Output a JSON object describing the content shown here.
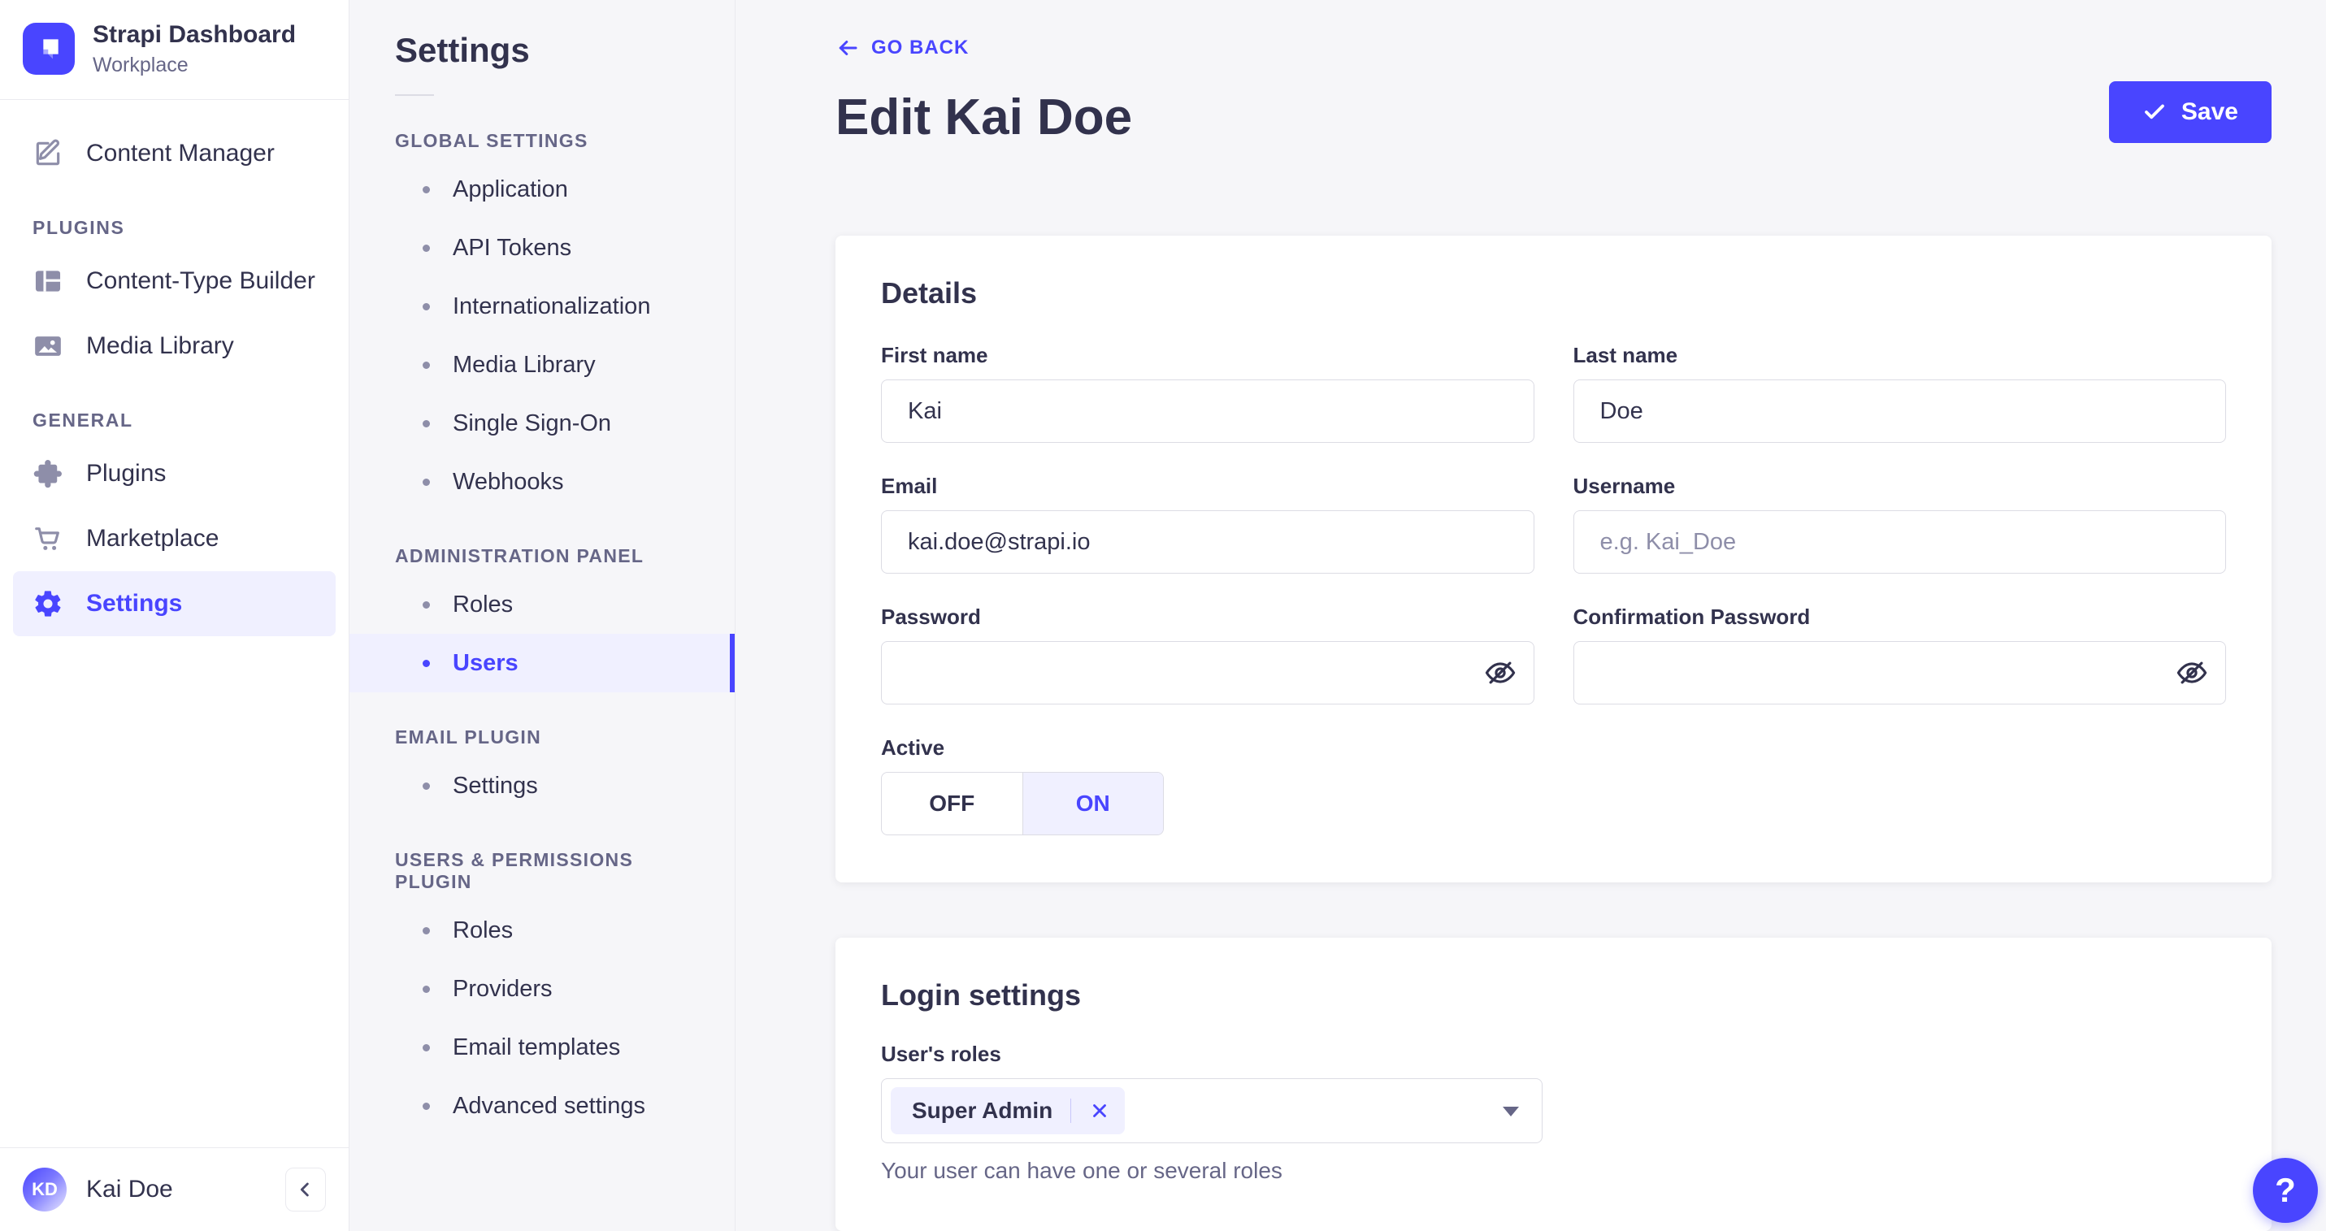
{
  "colors": {
    "primary": "#4945ff",
    "primary_light": "#f0f0ff",
    "text_dark": "#32324d",
    "text_muted": "#666687",
    "border": "#dcdce4",
    "divider": "#eaeaef",
    "background": "#f6f6f9",
    "surface": "#ffffff"
  },
  "main_sidebar": {
    "brand": {
      "title": "Strapi Dashboard",
      "subtitle": "Workplace",
      "logo_icon": "strapi-logo-icon"
    },
    "top_items": [
      {
        "label": "Content Manager",
        "icon": "pen-square-icon"
      }
    ],
    "sections": [
      {
        "label": "PLUGINS",
        "items": [
          {
            "label": "Content-Type Builder",
            "icon": "layout-grid-icon"
          },
          {
            "label": "Media Library",
            "icon": "image-icon"
          }
        ]
      },
      {
        "label": "GENERAL",
        "items": [
          {
            "label": "Plugins",
            "icon": "puzzle-icon"
          },
          {
            "label": "Marketplace",
            "icon": "cart-icon"
          },
          {
            "label": "Settings",
            "icon": "gear-icon",
            "active": true
          }
        ]
      }
    ],
    "user": {
      "name": "Kai Doe",
      "initials": "KD"
    },
    "collapse_icon": "chevron-left-icon"
  },
  "subnav": {
    "title": "Settings",
    "sections": [
      {
        "label": "GLOBAL SETTINGS",
        "items": [
          {
            "label": "Application"
          },
          {
            "label": "API Tokens"
          },
          {
            "label": "Internationalization"
          },
          {
            "label": "Media Library"
          },
          {
            "label": "Single Sign-On"
          },
          {
            "label": "Webhooks"
          }
        ]
      },
      {
        "label": "ADMINISTRATION PANEL",
        "items": [
          {
            "label": "Roles"
          },
          {
            "label": "Users",
            "active": true
          }
        ]
      },
      {
        "label": "EMAIL PLUGIN",
        "items": [
          {
            "label": "Settings"
          }
        ]
      },
      {
        "label": "USERS & PERMISSIONS PLUGIN",
        "items": [
          {
            "label": "Roles"
          },
          {
            "label": "Providers"
          },
          {
            "label": "Email templates"
          },
          {
            "label": "Advanced settings"
          }
        ]
      }
    ]
  },
  "main": {
    "go_back": "GO BACK",
    "title": "Edit Kai Doe",
    "save_label": "Save",
    "details": {
      "title": "Details",
      "fields": {
        "first_name": {
          "label": "First name",
          "value": "Kai"
        },
        "last_name": {
          "label": "Last name",
          "value": "Doe"
        },
        "email": {
          "label": "Email",
          "value": "kai.doe@strapi.io"
        },
        "username": {
          "label": "Username",
          "value": "",
          "placeholder": "e.g. Kai_Doe"
        },
        "password": {
          "label": "Password",
          "value": "",
          "icon": "eye-off-icon"
        },
        "confirmation_password": {
          "label": "Confirmation Password",
          "value": "",
          "icon": "eye-off-icon"
        }
      },
      "active_toggle": {
        "label": "Active",
        "off": "OFF",
        "on": "ON",
        "value": "ON"
      }
    },
    "login": {
      "title": "Login settings",
      "roles_label": "User's roles",
      "selected_roles": [
        "Super Admin"
      ],
      "remove_role_icon": "close-icon",
      "dropdown_icon": "caret-down-icon",
      "helper": "Your user can have one or several roles"
    }
  },
  "help_button": {
    "label": "?"
  }
}
